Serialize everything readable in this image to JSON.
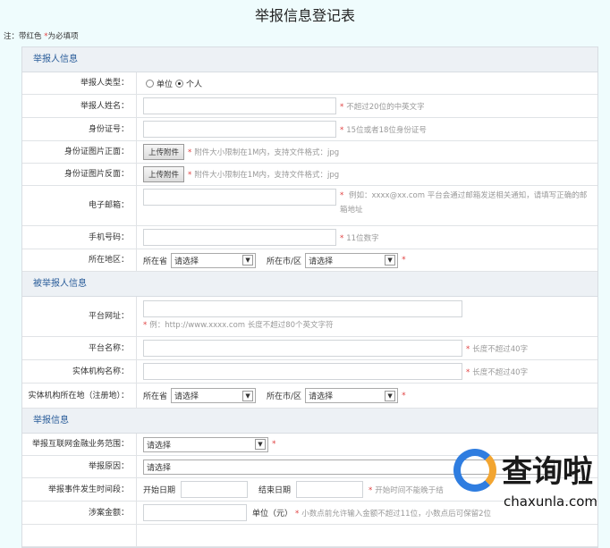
{
  "title": "举报信息登记表",
  "note": {
    "prefix": "注：带红色 ",
    "star": "*",
    "suffix": "为必填项"
  },
  "sections": {
    "reporter": "举报人信息",
    "reported": "被举报人信息",
    "report": "举报信息"
  },
  "reporter": {
    "type_label": "举报人类型：",
    "type_options": [
      "单位",
      "个人"
    ],
    "type_selected": "个人",
    "name_label": "举报人姓名：",
    "name_hint": "不超过20位的中英文字",
    "id_label": "身份证号：",
    "id_hint": "15位或者18位身份证号",
    "front_label": "身份证图片正面：",
    "back_label": "身份证图片反面：",
    "upload_label": "上传附件",
    "upload_hint": "附件大小限制在1M内，支持文件格式：jpg",
    "email_label": "电子邮箱：",
    "email_hint": "例如：xxxx@xx.com 平台会通过邮箱发送相关通知，请填写正确的邮箱地址",
    "phone_label": "手机号码：",
    "phone_hint": "11位数字",
    "region_label": "所在地区：",
    "province_label": "所在省",
    "city_label": "所在市/区",
    "select_placeholder": "请选择"
  },
  "reported": {
    "url_label": "平台网址：",
    "url_hint": "例：http://www.xxxx.com 长度不超过80个英文字符",
    "pname_label": "平台名称：",
    "pname_hint": "长度不超过40字",
    "ename_label": "实体机构名称：",
    "ename_hint": "长度不超过40字",
    "eloc_label": "实体机构所在地（注册地）："
  },
  "report": {
    "scope_label": "举报互联网金融业务范围：",
    "reason_label": "举报原因：",
    "period_label": "举报事件发生时间段：",
    "start_label": "开始日期",
    "end_label": "结束日期",
    "period_hint": "开始时间不能晚于结",
    "amount_label": "涉案金额：",
    "unit_label": "单位（元）",
    "amount_hint": "小数点前允许输入金额不超过11位，小数点后可保留2位"
  },
  "star": "*",
  "watermark": {
    "cn": "查询啦",
    "en": "chaxunla.com"
  }
}
